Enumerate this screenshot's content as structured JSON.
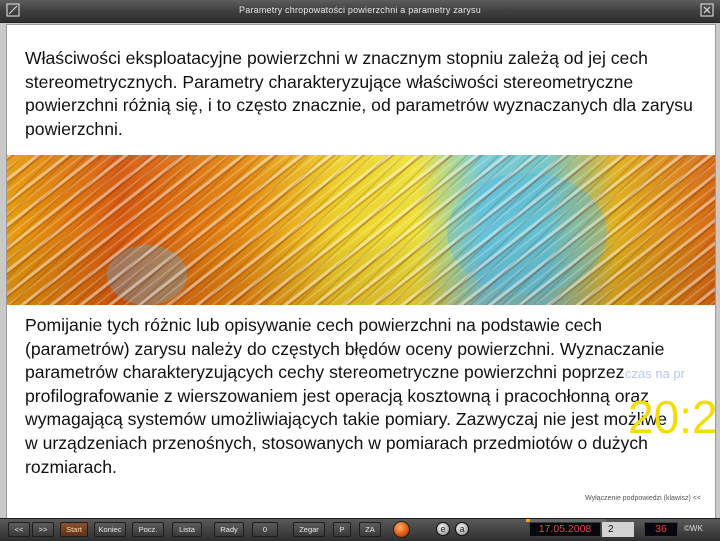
{
  "window": {
    "title": "Parametry chropowatości powierzchni a parametry zarysu"
  },
  "slide": {
    "paragraph_1": "Właściwości eksploatacyjne powierzchni w znacznym stopniu zależą od jej cech stereometrycznych. Parametry charakteryzujące właściwości stereometryczne powierzchni różnią się, i to często znacznie, od parametrów wyznaczanych dla zarysu powierzchni.",
    "paragraph_2": "Pomijanie tych różnic lub opisywanie cech powierzchni na podstawie cech (parametrów) zarysu należy do częstych błędów oceny powierzchni. Wyznaczanie parametrów charakteryzujących cechy stereometryczne powierzchni poprzez profilografowanie z wierszowaniem jest operacją kosztowną i pracochłonną oraz wymagającą systemów umożliwiających takie pomiary. Zazwyczaj nie jest możliwe w urządzeniach przenośnych, stosowanych w pomiarach przedmiotów o dużych rozmiarach.",
    "overlay_hint": "czas na pr",
    "overlay_clock": "20:2",
    "back_link": "Wyłączenie podpowiedzi (klawisz) <<"
  },
  "controls": {
    "buttons": [
      {
        "label": "<<"
      },
      {
        "label": ">>"
      },
      {
        "label": "Start"
      },
      {
        "label": "Koniec"
      },
      {
        "label": "Pocz."
      },
      {
        "label": "Lista"
      },
      {
        "label": "Rady"
      },
      {
        "label": "0"
      },
      {
        "label": "Zegar"
      },
      {
        "label": "P"
      },
      {
        "label": "ZA"
      }
    ],
    "round_buttons": [
      {
        "label": "e"
      },
      {
        "label": "a"
      }
    ],
    "date": "17.05.2008",
    "slide_number": "2",
    "total_slides": "36",
    "brand": "©WK",
    "progress_fraction": 0.05
  },
  "colors": {
    "slide_background": "#ffffff",
    "overlay_hint": "#b9c7f2",
    "overlay_clock": "#f2dd00",
    "progress": "#f7a020",
    "lcd_text": "#e04a3a"
  },
  "icons": {
    "title_left": "window-corner-icon",
    "title_right": "window-close-icon",
    "record": "record-button-icon"
  }
}
